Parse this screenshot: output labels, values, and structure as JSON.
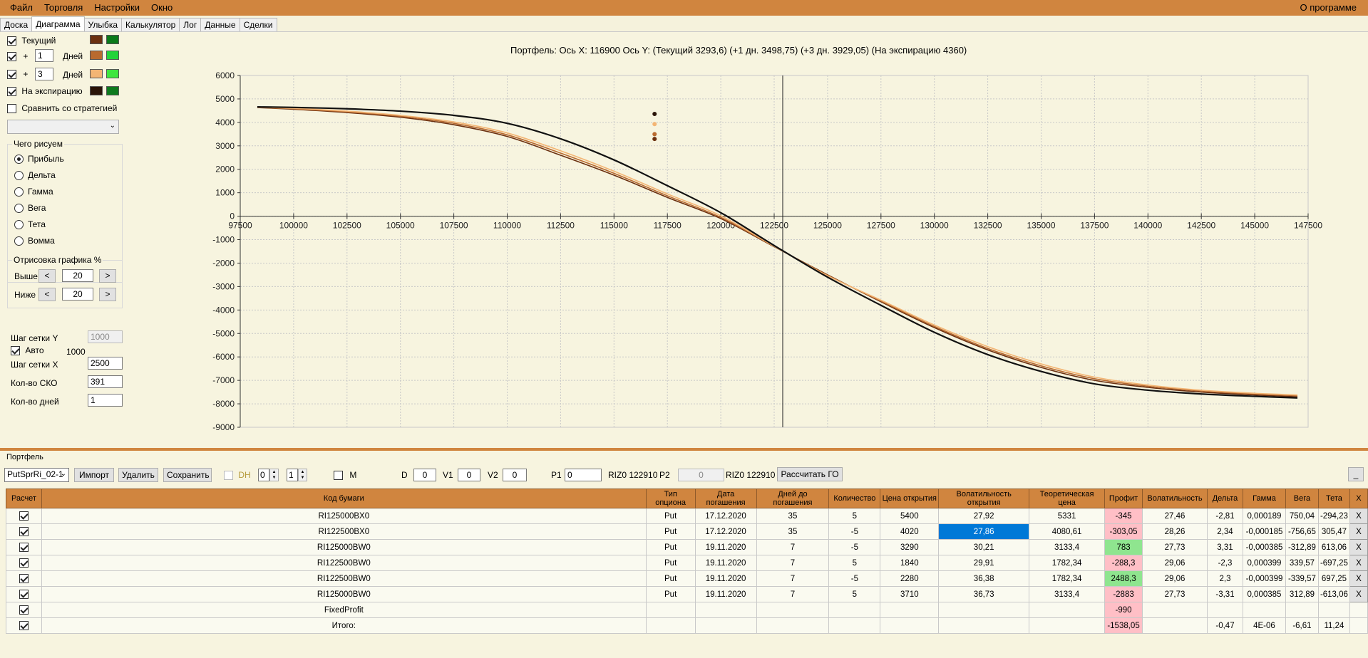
{
  "menu": {
    "file": "Файл",
    "trade": "Торговля",
    "settings": "Настройки",
    "window": "Окно",
    "about": "О программе"
  },
  "tabs": [
    "Доска",
    "Диаграмма",
    "Улыбка",
    "Калькулятор",
    "Лог",
    "Данные",
    "Сделки"
  ],
  "left": {
    "current": "Текущий",
    "plus": "+",
    "days1": "1",
    "days3": "3",
    "days_label": "Дней",
    "expiry": "На экспирацию",
    "compare": "Сравнить со стратегией",
    "draw_group": "Чего рисуем",
    "radios": [
      "Прибыль",
      "Дельта",
      "Гамма",
      "Вега",
      "Тета",
      "Вомма"
    ],
    "render_group": "Отрисовка графика %",
    "above": "Выше",
    "below": "Ниже",
    "above_val": "20",
    "below_val": "20",
    "grid_y": "Шаг сетки Y",
    "grid_y_val": "1000",
    "auto": "Авто",
    "auto_val": "1000",
    "grid_x": "Шаг сетки X",
    "grid_x_val": "2500",
    "sko": "Кол-во СКО",
    "sko_val": "391",
    "days_cnt": "Кол-во дней",
    "days_cnt_val": "1",
    "colors": {
      "current": [
        "#6b3010",
        "#0b7a1a"
      ],
      "plus1": [
        "#b96a2f",
        "#22d43a"
      ],
      "plus3": [
        "#f3b574",
        "#3ee63e"
      ],
      "expiry": [
        "#2a1408",
        "#0e7a1e"
      ]
    }
  },
  "chart_title": "Портфель: Ось X: 116900 Ось Y:  (Текущий 3293,6)  (+1 дн. 3498,75)  (+3 дн. 3929,05)  (На экспирацию 4360)",
  "chart_data": {
    "type": "line",
    "xlim": [
      97500,
      147500
    ],
    "ylim": [
      -9000,
      6000
    ],
    "x_ticks": [
      "97500",
      "100000",
      "102500",
      "105000",
      "107500",
      "110000",
      "112500",
      "115000",
      "117500",
      "120000",
      "122500",
      "125000",
      "127500",
      "130000",
      "132500",
      "135000",
      "137500",
      "140000",
      "142500",
      "145000",
      "147500"
    ],
    "y_ticks": [
      "6000",
      "5000",
      "4000",
      "3000",
      "2000",
      "1000",
      "0",
      "-1000",
      "-2000",
      "-3000",
      "-4000",
      "-5000",
      "-6000",
      "-7000",
      "-8000",
      "-9000"
    ],
    "cursor_x": 122900,
    "cursor_points": [
      {
        "x": 116900,
        "y": 4360,
        "color": "#2a1408"
      },
      {
        "x": 116900,
        "y": 3929,
        "color": "#f3b574"
      },
      {
        "x": 116900,
        "y": 3499,
        "color": "#b96a2f"
      },
      {
        "x": 116900,
        "y": 3294,
        "color": "#6b3010"
      }
    ],
    "series": [
      {
        "name": "Текущий",
        "color": "#6b3010",
        "x": [
          98300,
          100000,
          102500,
          105000,
          107500,
          110000,
          112500,
          115000,
          117500,
          120000,
          122500,
          125000,
          127500,
          130000,
          132500,
          135000,
          137500,
          140000,
          142500,
          145000,
          147000
        ],
        "y": [
          4630,
          4560,
          4420,
          4220,
          3900,
          3400,
          2600,
          1750,
          800,
          -100,
          -1300,
          -2500,
          -3650,
          -4750,
          -5700,
          -6450,
          -7000,
          -7300,
          -7500,
          -7620,
          -7700
        ]
      },
      {
        "name": "+1 дн.",
        "color": "#b96a2f",
        "x": [
          98300,
          100000,
          102500,
          105000,
          107500,
          110000,
          112500,
          115000,
          117500,
          120000,
          122500,
          125000,
          127500,
          130000,
          132500,
          135000,
          137500,
          140000,
          142500,
          145000,
          147000
        ],
        "y": [
          4640,
          4580,
          4450,
          4260,
          3960,
          3470,
          2690,
          1830,
          870,
          -50,
          -1290,
          -2520,
          -3620,
          -4700,
          -5640,
          -6380,
          -6930,
          -7250,
          -7450,
          -7580,
          -7650
        ]
      },
      {
        "name": "+3 дн.",
        "color": "#f3b574",
        "x": [
          98300,
          100000,
          102500,
          105000,
          107500,
          110000,
          112500,
          115000,
          117500,
          120000,
          122500,
          125000,
          127500,
          130000,
          132500,
          135000,
          137500,
          140000,
          142500,
          145000,
          147000
        ],
        "y": [
          4650,
          4600,
          4480,
          4300,
          4020,
          3550,
          2790,
          1920,
          950,
          20,
          -1280,
          -2540,
          -3580,
          -4640,
          -5560,
          -6300,
          -6860,
          -7200,
          -7420,
          -7550,
          -7620
        ]
      },
      {
        "name": "На экспирацию",
        "color": "#111111",
        "x": [
          98300,
          100000,
          102500,
          105000,
          107500,
          110000,
          112500,
          115000,
          117500,
          120000,
          122500,
          125000,
          127500,
          130000,
          132500,
          135000,
          137500,
          140000,
          142500,
          145000,
          147000
        ],
        "y": [
          4660,
          4640,
          4580,
          4480,
          4300,
          3960,
          3300,
          2400,
          1300,
          150,
          -1250,
          -2600,
          -3800,
          -4950,
          -5900,
          -6620,
          -7150,
          -7420,
          -7580,
          -7680,
          -7750
        ]
      }
    ]
  },
  "bottom": {
    "portfolio_label": "Портфель",
    "portfolio_select": "PutSprRi_02-1",
    "import": "Импорт",
    "delete": "Удалить",
    "save": "Сохранить",
    "dh": "DH",
    "spin1": "0",
    "spin2": "1",
    "m": "M",
    "d": "D",
    "d_val": "0",
    "v1": "V1",
    "v1_val": "0",
    "v2": "V2",
    "v2_val": "0",
    "p1": "P1",
    "p1_val": "0",
    "riz1": "RIZ0 122910",
    "p2": "P2",
    "p2_val": "0",
    "riz2": "RIZ0 122910",
    "calc_go": "Рассчитать ГО",
    "minimize": "_"
  },
  "table": {
    "headers": [
      "Расчет",
      "Код бумаги",
      "Тип опциона",
      "Дата погашения",
      "Дней до погашения",
      "Количество",
      "Цена открытия",
      "Волатильность открытия",
      "Теоретическая цена",
      "Профит",
      "Волатильность",
      "Дельта",
      "Гамма",
      "Вега",
      "Тета",
      "X"
    ],
    "rows": [
      [
        "RI125000BX0",
        "Put",
        "17.12.2020",
        "35",
        "5",
        "5400",
        "27,92",
        "5331",
        "-345",
        "27,46",
        "-2,81",
        "0,000189",
        "750,04",
        "-294,23",
        "X"
      ],
      [
        "RI122500BX0",
        "Put",
        "17.12.2020",
        "35",
        "-5",
        "4020",
        "27,86",
        "4080,61",
        "-303,05",
        "28,26",
        "2,34",
        "-0,000185",
        "-756,65",
        "305,47",
        "X"
      ],
      [
        "RI125000BW0",
        "Put",
        "19.11.2020",
        "7",
        "-5",
        "3290",
        "30,21",
        "3133,4",
        "783",
        "27,73",
        "3,31",
        "-0,000385",
        "-312,89",
        "613,06",
        "X"
      ],
      [
        "RI122500BW0",
        "Put",
        "19.11.2020",
        "7",
        "5",
        "1840",
        "29,91",
        "1782,34",
        "-288,3",
        "29,06",
        "-2,3",
        "0,000399",
        "339,57",
        "-697,25",
        "X"
      ],
      [
        "RI122500BW0",
        "Put",
        "19.11.2020",
        "7",
        "-5",
        "2280",
        "36,38",
        "1782,34",
        "2488,3",
        "29,06",
        "2,3",
        "-0,000399",
        "-339,57",
        "697,25",
        "X"
      ],
      [
        "RI125000BW0",
        "Put",
        "19.11.2020",
        "7",
        "5",
        "3710",
        "36,73",
        "3133,4",
        "-2883",
        "27,73",
        "-3,31",
        "0,000385",
        "312,89",
        "-613,06",
        "X"
      ],
      [
        "FixedProfit",
        "",
        "",
        "",
        "",
        "",
        "",
        "",
        "-990",
        "",
        "",
        "",
        "",
        "",
        ""
      ],
      [
        "Итого:",
        "",
        "",
        "",
        "",
        "",
        "",
        "",
        "-1538,05",
        "",
        "-0,47",
        "4E-06",
        "-6,61",
        "11,24",
        ""
      ]
    ]
  }
}
